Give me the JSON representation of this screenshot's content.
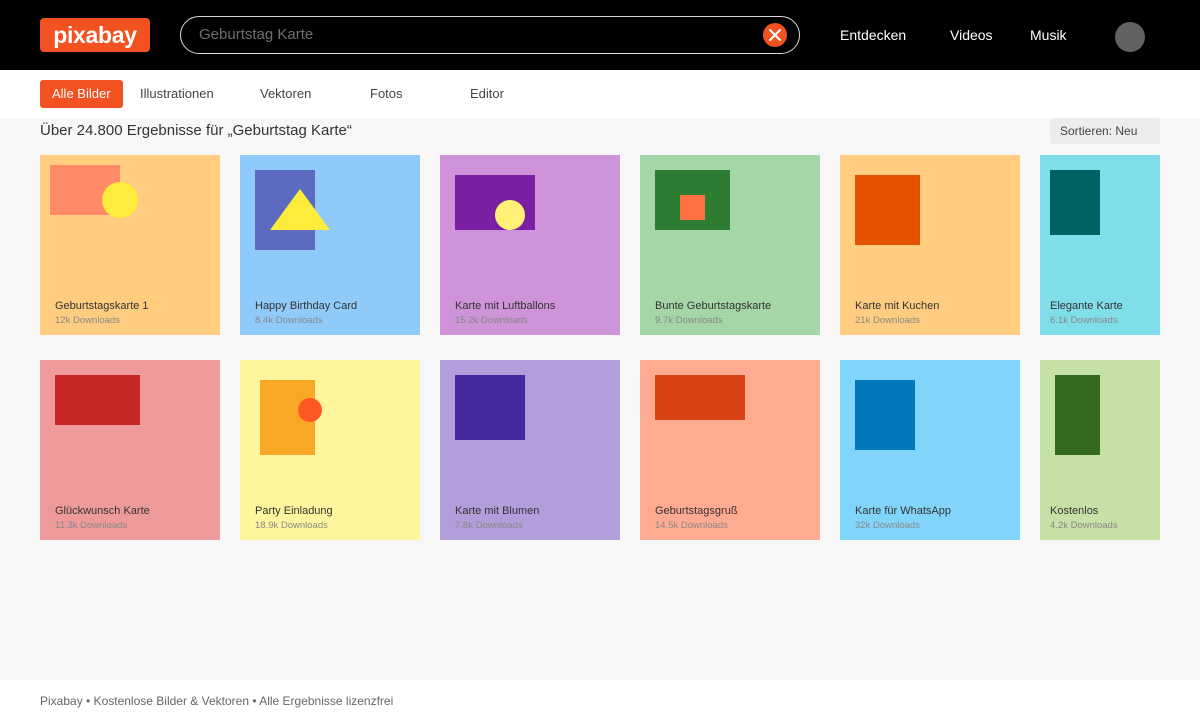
{
  "header": {
    "logo": "pixabay",
    "search": {
      "placeholder": "Geburtstag Karte",
      "value": ""
    },
    "nav": [
      "Entdecken",
      "Videos",
      "Musik"
    ]
  },
  "filters": {
    "tabs": [
      "Alle Bilder",
      "Illustrationen",
      "Vektoren",
      "Fotos",
      "Editor"
    ],
    "active": "Alle Bilder"
  },
  "results": {
    "title": "Über 24.800 Ergebnisse für „Geburtstag Karte“",
    "sort_label": "Sortieren: Neu"
  },
  "cards": [
    {
      "title": "Geburtstagskarte 1",
      "downloads": "12k Downloads",
      "bg": "#ffcc80"
    },
    {
      "title": "Happy Birthday Card",
      "downloads": "8.4k Downloads",
      "bg": "#90caf9"
    },
    {
      "title": "Karte mit Luftballons",
      "downloads": "15.2k Downloads",
      "bg": "#ce93d8"
    },
    {
      "title": "Bunte Geburtstagskarte",
      "downloads": "9.7k Downloads",
      "bg": "#a5d6a7"
    },
    {
      "title": "Karte mit Kuchen",
      "downloads": "21k Downloads",
      "bg": "#ffcc80"
    },
    {
      "title": "Elegante Karte",
      "downloads": "6.1k Downloads",
      "bg": "#80deea"
    },
    {
      "title": "Glückwunsch Karte",
      "downloads": "11.3k Downloads",
      "bg": "#ef9a9a"
    },
    {
      "title": "Party Einladung",
      "downloads": "18.9k Downloads",
      "bg": "#fff59d"
    },
    {
      "title": "Karte mit Blumen",
      "downloads": "7.8k Downloads",
      "bg": "#b39ddb"
    },
    {
      "title": "Geburtstagsgruß",
      "downloads": "14.5k Downloads",
      "bg": "#ffab91"
    },
    {
      "title": "Karte für WhatsApp",
      "downloads": "32k Downloads",
      "bg": "#81d4fa"
    },
    {
      "title": "Kostenlos",
      "downloads": "4.2k Downloads",
      "bg": "#c5e1a5"
    }
  ],
  "footer": {
    "text": "Pixabay • Kostenlose Bilder & Vektoren • Alle Ergebnisse lizenzfrei"
  },
  "colors": {
    "brand": "#f1521f",
    "topbar": "#000000"
  }
}
